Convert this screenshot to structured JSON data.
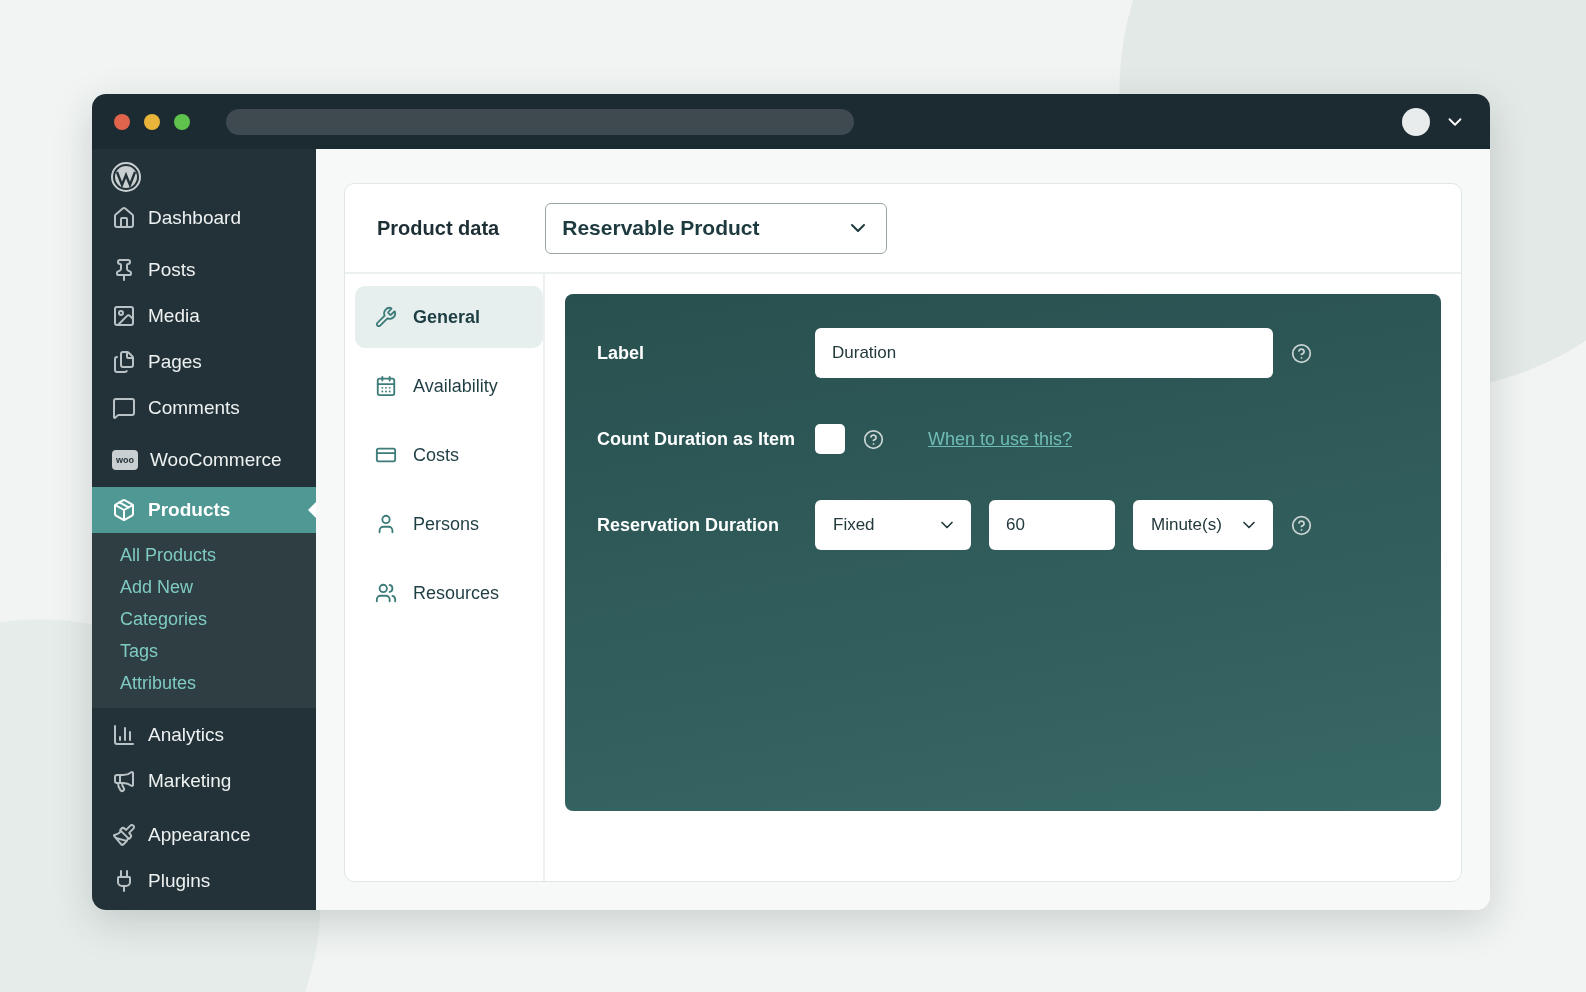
{
  "sidebar": {
    "items": [
      {
        "label": "Dashboard",
        "selected": false
      },
      {
        "label": "Posts",
        "selected": false
      },
      {
        "label": "Media",
        "selected": false
      },
      {
        "label": "Pages",
        "selected": false
      },
      {
        "label": "Comments",
        "selected": false
      },
      {
        "label": "WooCommerce",
        "badge": "woo",
        "selected": false
      },
      {
        "label": "Products",
        "selected": true,
        "children": [
          {
            "label": "All Products"
          },
          {
            "label": "Add New"
          },
          {
            "label": "Categories"
          },
          {
            "label": "Tags"
          },
          {
            "label": "Attributes"
          }
        ]
      },
      {
        "label": "Analytics",
        "selected": false
      },
      {
        "label": "Marketing",
        "selected": false
      },
      {
        "label": "Appearance",
        "selected": false
      },
      {
        "label": "Plugins",
        "selected": false
      }
    ]
  },
  "product_data": {
    "title": "Product data",
    "type_select": "Reservable Product",
    "tabs": [
      {
        "label": "General",
        "selected": true
      },
      {
        "label": "Availability",
        "selected": false
      },
      {
        "label": "Costs",
        "selected": false
      },
      {
        "label": "Persons",
        "selected": false
      },
      {
        "label": "Resources",
        "selected": false
      }
    ],
    "fields": [
      {
        "kind": "text",
        "label": "Label",
        "value": "Duration"
      },
      {
        "kind": "checkbox",
        "label": "Count Duration as Item",
        "checked": false,
        "link": "When to use this?"
      },
      {
        "kind": "duration",
        "label": "Reservation Duration",
        "type": "Fixed",
        "amount": "60",
        "unit": "Minute(s)"
      }
    ]
  }
}
